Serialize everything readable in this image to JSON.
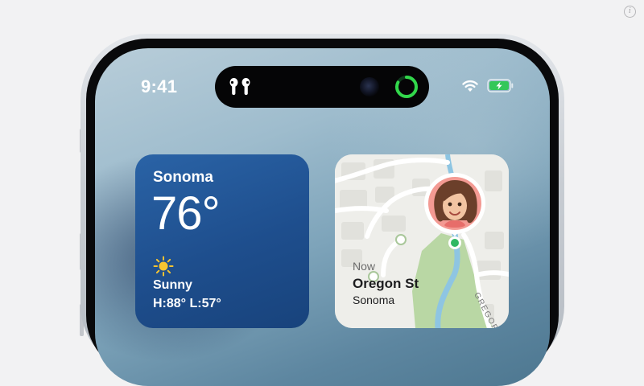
{
  "overlay": {
    "info_icon": "info-icon",
    "info_glyph": "i"
  },
  "status_bar": {
    "time": "9:41",
    "dynamic_island": {
      "left_activity_icon": "airpods-icon",
      "right_activity_icon": "activity-ring-icon",
      "ring_color": "#32d74b"
    },
    "wifi_icon": "wifi-icon",
    "battery_icon": "battery-charging-icon",
    "battery_color": "#34c759"
  },
  "widgets": {
    "weather": {
      "city": "Sonoma",
      "temperature": "76°",
      "condition_icon": "sun-icon",
      "condition": "Sunny",
      "high_low": "H:88° L:57°",
      "background": "#1f4f8f"
    },
    "find_my": {
      "label": "Now",
      "street": "Oregon St",
      "city": "Sonoma",
      "map_road_label": "GREGORY CIR",
      "avatar_icon": "memoji-avatar"
    }
  }
}
